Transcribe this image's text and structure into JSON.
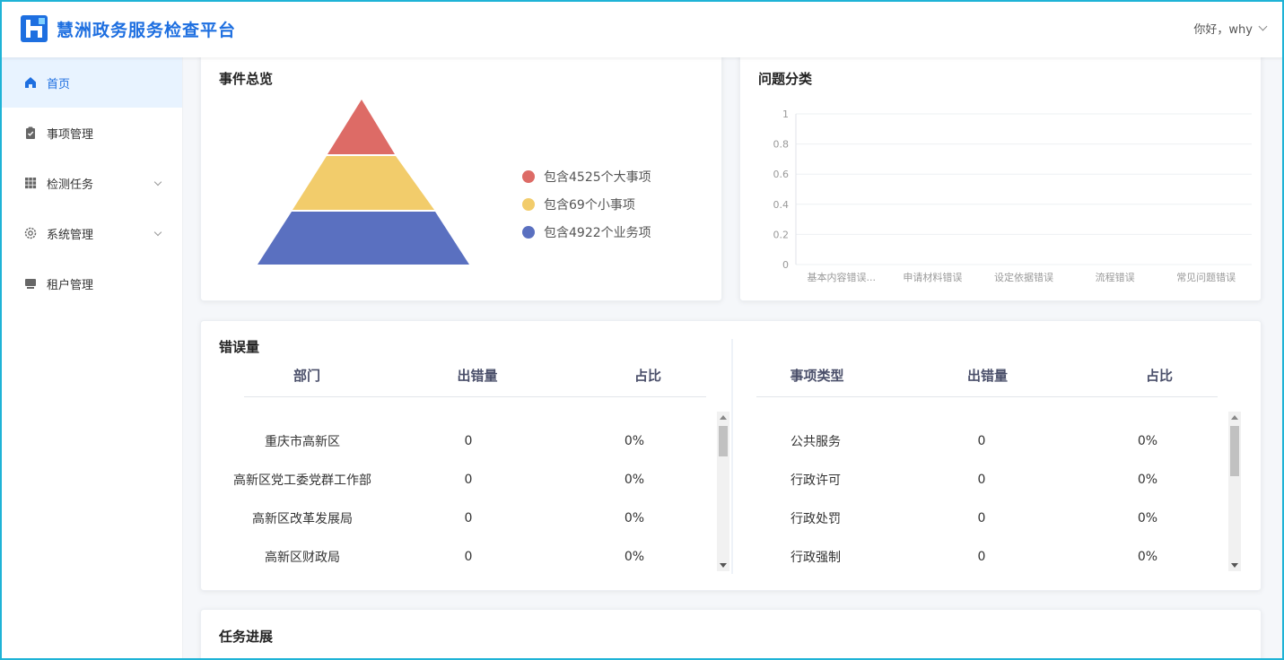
{
  "header": {
    "app_title": "慧洲政务服务检查平台",
    "greeting": "你好，why"
  },
  "sidebar": {
    "items": [
      {
        "label": "首页",
        "icon": "home-icon",
        "active": true
      },
      {
        "label": "事项管理",
        "icon": "clipboard-icon"
      },
      {
        "label": "检测任务",
        "icon": "grid-icon",
        "expandable": true
      },
      {
        "label": "系统管理",
        "icon": "gear-icon",
        "expandable": true
      },
      {
        "label": "租户管理",
        "icon": "tenant-icon"
      }
    ]
  },
  "events": {
    "title": "事件总览",
    "legend": [
      {
        "label": "包含4525个大事项",
        "color": "#dd6b66"
      },
      {
        "label": "包含69个小事项",
        "color": "#f2cc6b"
      },
      {
        "label": "包含4922个业务项",
        "color": "#5a70c0"
      }
    ]
  },
  "issues": {
    "title": "问题分类"
  },
  "chart_data": {
    "type": "bar",
    "categories": [
      "基本内容错误...",
      "申请材料错误",
      "设定依据错误",
      "流程错误",
      "常见问题错误"
    ],
    "values": [
      0,
      0,
      0,
      0,
      0
    ],
    "ylim": [
      0,
      1
    ],
    "yticks": [
      "0",
      "0.2",
      "0.4",
      "0.6",
      "0.8",
      "1"
    ],
    "grid": true
  },
  "errors": {
    "title": "错误量",
    "dept_table": {
      "headers": [
        "部门",
        "出错量",
        "占比"
      ],
      "rows": [
        [
          "重庆市高新区",
          "0",
          "0%"
        ],
        [
          "高新区党工委党群工作部",
          "0",
          "0%"
        ],
        [
          "高新区改革发展局",
          "0",
          "0%"
        ],
        [
          "高新区财政局",
          "0",
          "0%"
        ]
      ]
    },
    "type_table": {
      "headers": [
        "事项类型",
        "出错量",
        "占比"
      ],
      "rows": [
        [
          "公共服务",
          "0",
          "0%"
        ],
        [
          "行政许可",
          "0",
          "0%"
        ],
        [
          "行政处罚",
          "0",
          "0%"
        ],
        [
          "行政强制",
          "0",
          "0%"
        ]
      ]
    }
  },
  "progress": {
    "title": "任务进展"
  }
}
